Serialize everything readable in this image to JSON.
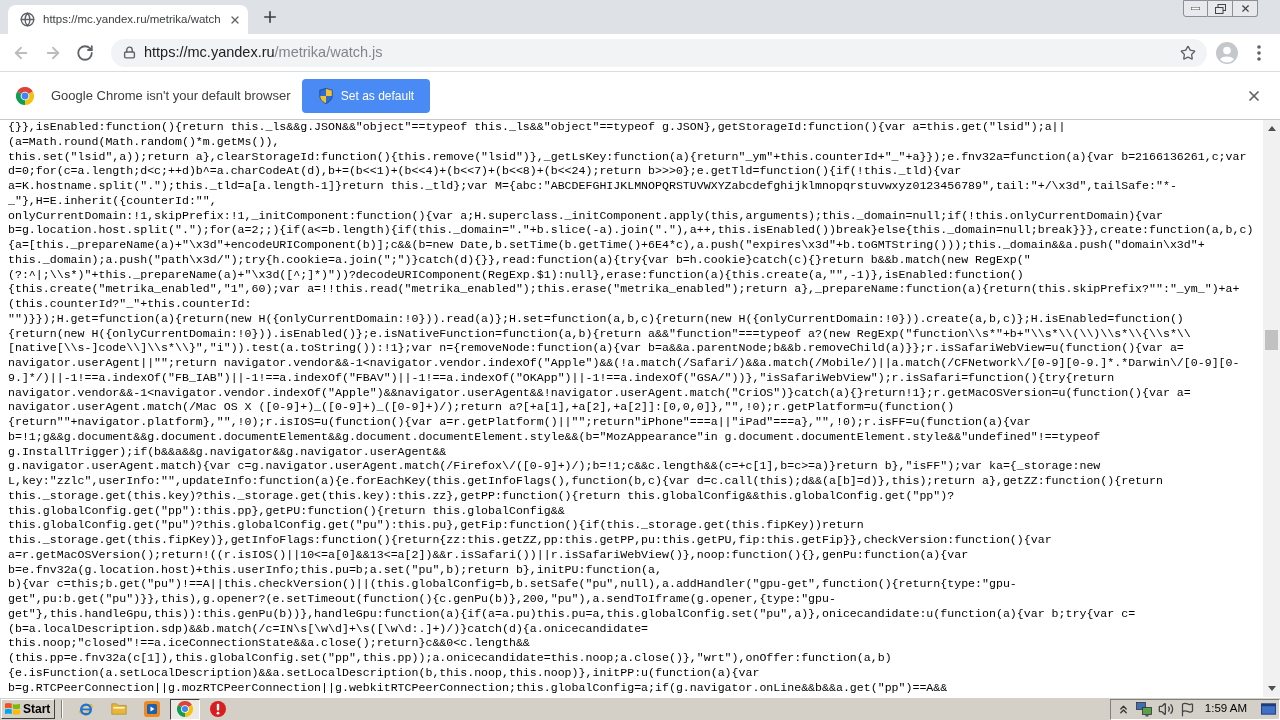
{
  "tabs": [
    {
      "title": "https://mc.yandex.ru/metrika/watch",
      "selected": true
    }
  ],
  "toolbar": {
    "nav_buttons": [
      {
        "kind": "back",
        "disabled": true
      },
      {
        "kind": "forward",
        "disabled": true
      },
      {
        "kind": "reload",
        "disabled": false
      }
    ],
    "url": {
      "host": "https://mc.yandex.ru",
      "path": "/metrika/watch.js"
    }
  },
  "infobar": {
    "message": "Google Chrome isn't your default browser",
    "button": "Set as default"
  },
  "page": {
    "lines": [
      "{}},isEnabled:function(){return this._ls&&g.JSON&&\"object\"==typeof this._ls&&\"object\"==typeof g.JSON},getStorageId:function(){var a=this.get(\"lsid\");a||",
      "(a=Math.round(Math.random()*m.getMs()),",
      "this.set(\"lsid\",a));return a},clearStorageId:function(){this.remove(\"lsid\")},_getLsKey:function(a){return\"_ym\"+this.counterId+\"_\"+a}});e.fnv32a=function(a){var b=2166136261,c;var",
      "d=0;for(c=a.length;d<c;++d)b^=a.charCodeAt(d),b+=(b<<1)+(b<<4)+(b<<7)+(b<<8)+(b<<24);return b>>>0};e.getTld=function(){if(!this._tld){var",
      "a=K.hostname.split(\".\");this._tld=a[a.length-1]}return this._tld};var M={abc:\"ABCDEFGHIJKLMNOPQRSTUVWXYZabcdefghijklmnopqrstuvwxyz0123456789\",tail:\"+/\\x3d\",tailSafe:\"*-",
      "_\"},H=E.inherit({counterId:\"\",",
      "onlyCurrentDomain:!1,skipPrefix:!1,_initComponent:function(){var a;H.superclass._initComponent.apply(this,arguments);this._domain=null;if(!this.onlyCurrentDomain){var",
      "b=g.location.host.split(\".\");for(a=2;;){if(a<=b.length){if(this._domain=\".\"+b.slice(-a).join(\".\"),a++,this.isEnabled())break}else{this._domain=null;break}}},create:function(a,b,c)",
      "{a=[this._prepareName(a)+\"\\x3d\"+encodeURIComponent(b)];c&&(b=new Date,b.setTime(b.getTime()+6E4*c),a.push(\"expires\\x3d\"+b.toGMTString()));this._domain&&a.push(\"domain\\x3d\"+",
      "this._domain);a.push(\"path\\x3d/\");try{h.cookie=a.join(\";\")}catch(d){}},read:function(a){try{var b=h.cookie}catch(c){}return b&&b.match(new RegExp(\"",
      "(?:^|;\\\\s*)\"+this._prepareName(a)+\"\\x3d([^;]*)\"))?decodeURIComponent(RegExp.$1):null},erase:function(a){this.create(a,\"\",-1)},isEnabled:function()",
      "{this.create(\"metrika_enabled\",\"1\",60);var a=!!this.read(\"metrika_enabled\");this.erase(\"metrika_enabled\");return a},_prepareName:function(a){return(this.skipPrefix?\"\":\"_ym_\")+a+",
      "(this.counterId?\"_\"+this.counterId:",
      "\"\")}});H.get=function(a){return(new H({onlyCurrentDomain:!0})).read(a)};H.set=function(a,b,c){return(new H({onlyCurrentDomain:!0})).create(a,b,c)};H.isEnabled=function()",
      "{return(new H({onlyCurrentDomain:!0})).isEnabled()};e.isNativeFunction=function(a,b){return a&&\"function\"===typeof a?(new RegExp(\"function\\\\s*\"+b+\"\\\\s*\\\\(\\\\)\\\\s*\\\\{\\\\s*\\\\",
      "[native[\\\\s-]code\\\\]\\\\s*\\\\}\",\"i\")).test(a.toString()):!1};var n={removeNode:function(a){var b=a&&a.parentNode;b&&b.removeChild(a)}};r.isSafariWebView=u(function(){var a=",
      "navigator.userAgent||\"\";return navigator.vendor&&-1<navigator.vendor.indexOf(\"Apple\")&&(!a.match(/Safari/)&&a.match(/Mobile/)||a.match(/CFNetwork\\/[0-9][0-9.]*.*Darwin\\/[0-9][0-",
      "9.]*/)||-1!==a.indexOf(\"FB_IAB\")||-1!==a.indexOf(\"FBAV\")||-1!==a.indexOf(\"OKApp\")||-1!==a.indexOf(\"GSA/\"))},\"isSafariWebView\");r.isSafari=function(){try{return",
      "navigator.vendor&&-1<navigator.vendor.indexOf(\"Apple\")&&navigator.userAgent&&!navigator.userAgent.match(\"CriOS\")}catch(a){}return!1};r.getMacOSVersion=u(function(){var a=",
      "navigator.userAgent.match(/Mac OS X ([0-9]+)_([0-9]+)_([0-9]+)/);return a?[+a[1],+a[2],+a[2]]:[0,0,0]},\"\",!0);r.getPlatform=u(function()",
      "{return\"\"+navigator.platform},\"\",!0);r.isIOS=u(function(){var a=r.getPlatform()||\"\";return\"iPhone\"===a||\"iPad\"===a},\"\",!0);r.isFF=u(function(a){var",
      "b=!1;g&&g.document&&g.document.documentElement&&g.document.documentElement.style&&(b=\"MozAppearance\"in g.document.documentElement.style&&\"undefined\"!==typeof",
      "g.InstallTrigger);if(b&&a&&g.navigator&&g.navigator.userAgent&&",
      "g.navigator.userAgent.match){var c=g.navigator.userAgent.match(/Firefox\\/([0-9]+)/);b=!1;c&&c.length&&(c=+c[1],b=c>=a)}return b},\"isFF\");var ka={_storage:new",
      "L,key:\"zzlc\",userInfo:\"\",updateInfo:function(a){e.forEachKey(this.getInfoFlags(),function(b,c){var d=c.call(this);d&&(a[b]=d)},this);return a},getZZ:function(){return",
      "this._storage.get(this.key)?this._storage.get(this.key):this.zz},getPP:function(){return this.globalConfig&&this.globalConfig.get(\"pp\")?",
      "this.globalConfig.get(\"pp\"):this.pp},getPU:function(){return this.globalConfig&&",
      "this.globalConfig.get(\"pu\")?this.globalConfig.get(\"pu\"):this.pu},getFip:function(){if(this._storage.get(this.fipKey))return",
      "this._storage.get(this.fipKey)},getInfoFlags:function(){return{zz:this.getZZ,pp:this.getPP,pu:this.getPU,fip:this.getFip}},checkVersion:function(){var",
      "a=r.getMacOSVersion();return!((r.isIOS()||10<=a[0]&&13<=a[2])&&r.isSafari())||r.isSafariWebView()},noop:function(){},genPu:function(a){var",
      "b=e.fnv32a(g.location.host)+this.userInfo;this.pu=b;a.set(\"pu\",b);return b},initPU:function(a,",
      "b){var c=this;b.get(\"pu\")!==A||this.checkVersion()||(this.globalConfig=b,b.setSafe(\"pu\",null),a.addHandler(\"gpu-get\",function(){return{type:\"gpu-",
      "get\",pu:b.get(\"pu\")}},this),g.opener?(e.setTimeout(function(){c.genPu(b)},200,\"pu\"),a.sendToIframe(g.opener,{type:\"gpu-",
      "get\"},this.handleGpu,this)):this.genPu(b))},handleGpu:function(a){if(a=a.pu)this.pu=a,this.globalConfig.set(\"pu\",a)},onicecandidate:u(function(a){var b;try{var c=",
      "(b=a.localDescription.sdp)&&b.match(/c=IN\\s[\\w\\d]+\\s([\\w\\d:.]+)/)}catch(d){a.onicecandidate=",
      "this.noop;\"closed\"!==a.iceConnectionState&&a.close();return}c&&0<c.length&&",
      "(this.pp=e.fnv32a(c[1]),this.globalConfig.set(\"pp\",this.pp));a.onicecandidate=this.noop;a.close()},\"wrt\"),onOffer:function(a,b)",
      "{e.isFunction(a.setLocalDescription)&&a.setLocalDescription(b,this.noop,this.noop)},initPP:u(function(a){var",
      "b=g.RTCPeerConnection||g.mozRTCPeerConnection||g.webkitRTCPeerConnection;this.globalConfig=a;if(g.navigator.onLine&&b&&a.get(\"pp\")==A&&"
    ]
  },
  "taskbar": {
    "start": "Start",
    "apps": [
      {
        "kind": "ie",
        "selected": false
      },
      {
        "kind": "folder",
        "selected": false
      },
      {
        "kind": "media",
        "selected": false
      },
      {
        "kind": "chrome",
        "selected": true
      },
      {
        "kind": "alert",
        "selected": false
      }
    ],
    "clock": "1:59 AM"
  }
}
